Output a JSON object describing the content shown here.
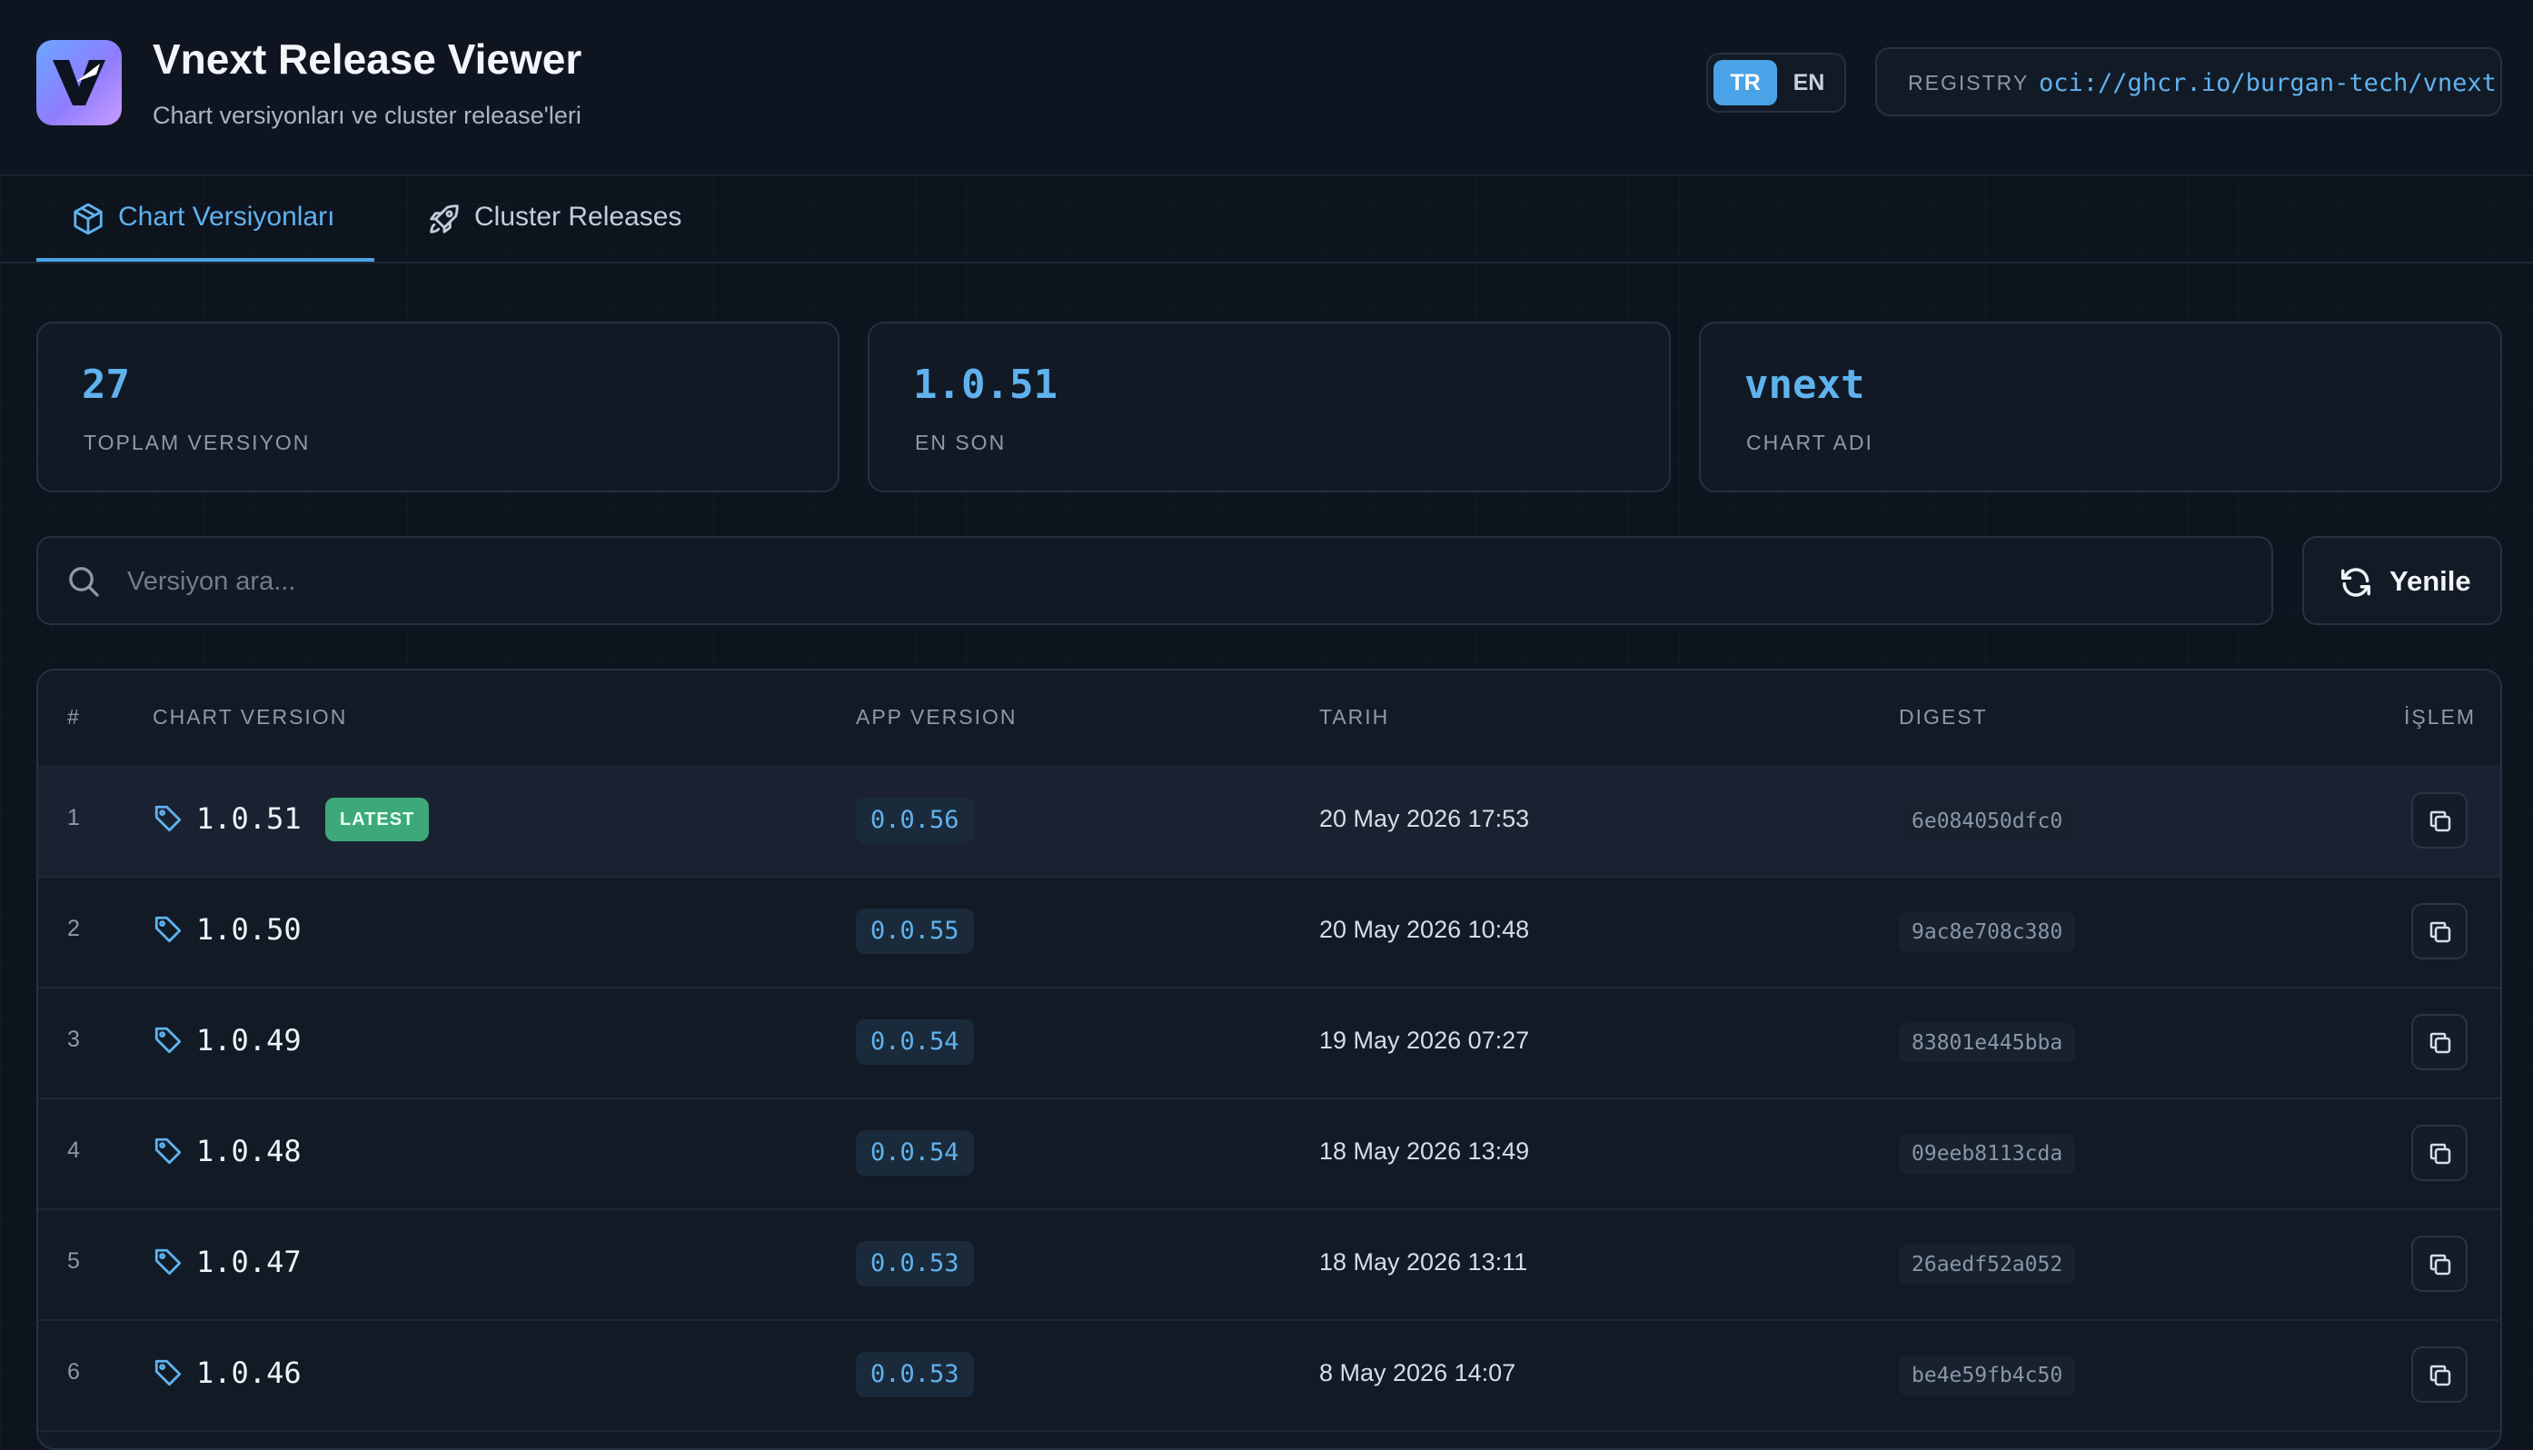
{
  "header": {
    "title": "Vnext Release Viewer",
    "subtitle": "Chart versiyonları ve cluster release'leri",
    "lang": {
      "tr": "TR",
      "en": "EN",
      "selected": "TR"
    },
    "registry": {
      "label": "REGISTRY",
      "value": "oci://ghcr.io/burgan-tech/vnext"
    }
  },
  "tabs": [
    {
      "label": "Chart Versiyonları",
      "icon": "cube-icon",
      "active": true
    },
    {
      "label": "Cluster Releases",
      "icon": "rocket-icon",
      "active": false
    }
  ],
  "stats": [
    {
      "value": "27",
      "label": "TOPLAM VERSIYON"
    },
    {
      "value": "1.0.51",
      "label": "EN SON"
    },
    {
      "value": "vnext",
      "label": "CHART ADI"
    }
  ],
  "search": {
    "placeholder": "Versiyon ara...",
    "value": "",
    "icon": "search-icon"
  },
  "refresh": {
    "label": "Yenile",
    "icon": "refresh-icon"
  },
  "table": {
    "columns": [
      "#",
      "CHART VERSION",
      "APP VERSION",
      "TARIH",
      "DIGEST",
      "İŞLEM"
    ],
    "latest_badge": "LATEST",
    "rows": [
      {
        "index": "1",
        "chart_version": "1.0.51",
        "app_version": "0.0.56",
        "date": "20 May 2026 17:53",
        "digest": "6e084050dfc0"
      },
      {
        "index": "2",
        "chart_version": "1.0.50",
        "app_version": "0.0.55",
        "date": "20 May 2026 10:48",
        "digest": "9ac8e708c380"
      },
      {
        "index": "3",
        "chart_version": "1.0.49",
        "app_version": "0.0.54",
        "date": "19 May 2026 07:27",
        "digest": "83801e445bba"
      },
      {
        "index": "4",
        "chart_version": "1.0.48",
        "app_version": "0.0.54",
        "date": "18 May 2026 13:49",
        "digest": "09eeb8113cda"
      },
      {
        "index": "5",
        "chart_version": "1.0.47",
        "app_version": "0.0.53",
        "date": "18 May 2026 13:11",
        "digest": "26aedf52a052"
      },
      {
        "index": "6",
        "chart_version": "1.0.46",
        "app_version": "0.0.53",
        "date": "8 May 2026 14:07",
        "digest": "be4e59fb4c50"
      }
    ]
  },
  "colors": {
    "accent": "#4aa3e6",
    "background": "#0e141e",
    "latest": "#3da97a"
  }
}
